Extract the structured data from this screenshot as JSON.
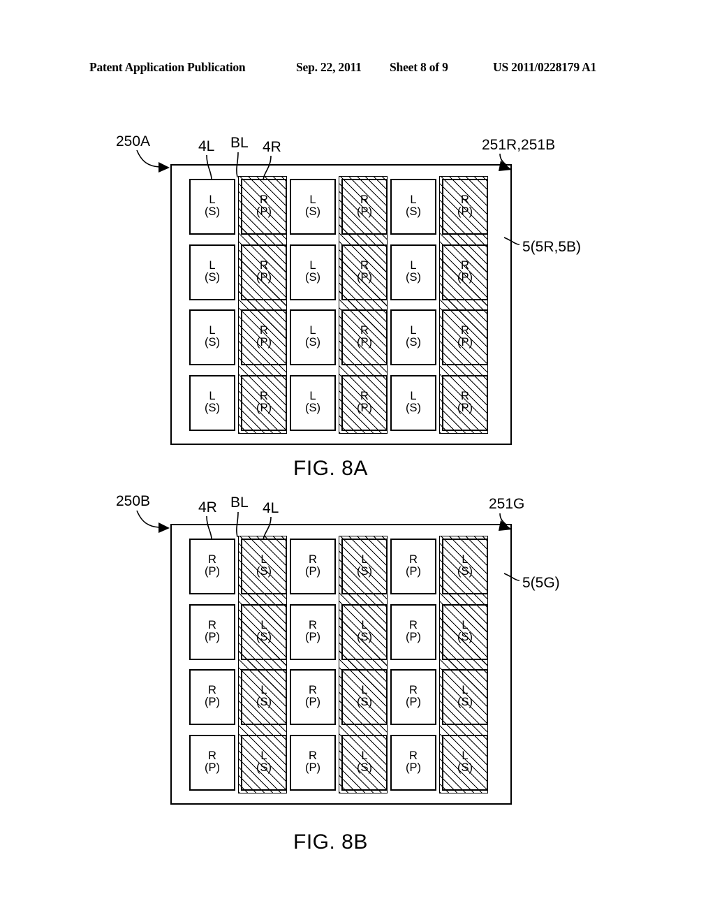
{
  "header": {
    "left": "Patent Application Publication",
    "date": "Sep. 22, 2011",
    "sheet": "Sheet 8 of 9",
    "doc_number": "US 2011/0228179 A1"
  },
  "figures": [
    {
      "id": "fig-8a",
      "caption": "FIG. 8A",
      "labels": {
        "device": "250A",
        "top_left_cell": "4L",
        "top_mid_strip": "BL",
        "top_right_cell": "4R",
        "top_right_corner": "251R,251B",
        "right_side": "5(5R,5B)"
      },
      "columns": [
        {
          "kind": "white",
          "line1": "L",
          "line2": "(S)"
        },
        {
          "kind": "hatched",
          "line1": "R",
          "line2": "(P)"
        },
        {
          "kind": "white",
          "line1": "L",
          "line2": "(S)"
        },
        {
          "kind": "hatched",
          "line1": "R",
          "line2": "(P)"
        },
        {
          "kind": "white",
          "line1": "L",
          "line2": "(S)"
        },
        {
          "kind": "hatched",
          "line1": "R",
          "line2": "(P)"
        }
      ],
      "rows": 4
    },
    {
      "id": "fig-8b",
      "caption": "FIG. 8B",
      "labels": {
        "device": "250B",
        "top_left_cell": "4R",
        "top_mid_strip": "BL",
        "top_right_cell": "4L",
        "top_right_corner": "251G",
        "right_side": "5(5G)"
      },
      "columns": [
        {
          "kind": "white",
          "line1": "R",
          "line2": "(P)"
        },
        {
          "kind": "hatched",
          "line1": "L",
          "line2": "(S)"
        },
        {
          "kind": "white",
          "line1": "R",
          "line2": "(P)"
        },
        {
          "kind": "hatched",
          "line1": "L",
          "line2": "(S)"
        },
        {
          "kind": "white",
          "line1": "R",
          "line2": "(P)"
        },
        {
          "kind": "hatched",
          "line1": "L",
          "line2": "(S)"
        }
      ],
      "rows": 4
    }
  ]
}
